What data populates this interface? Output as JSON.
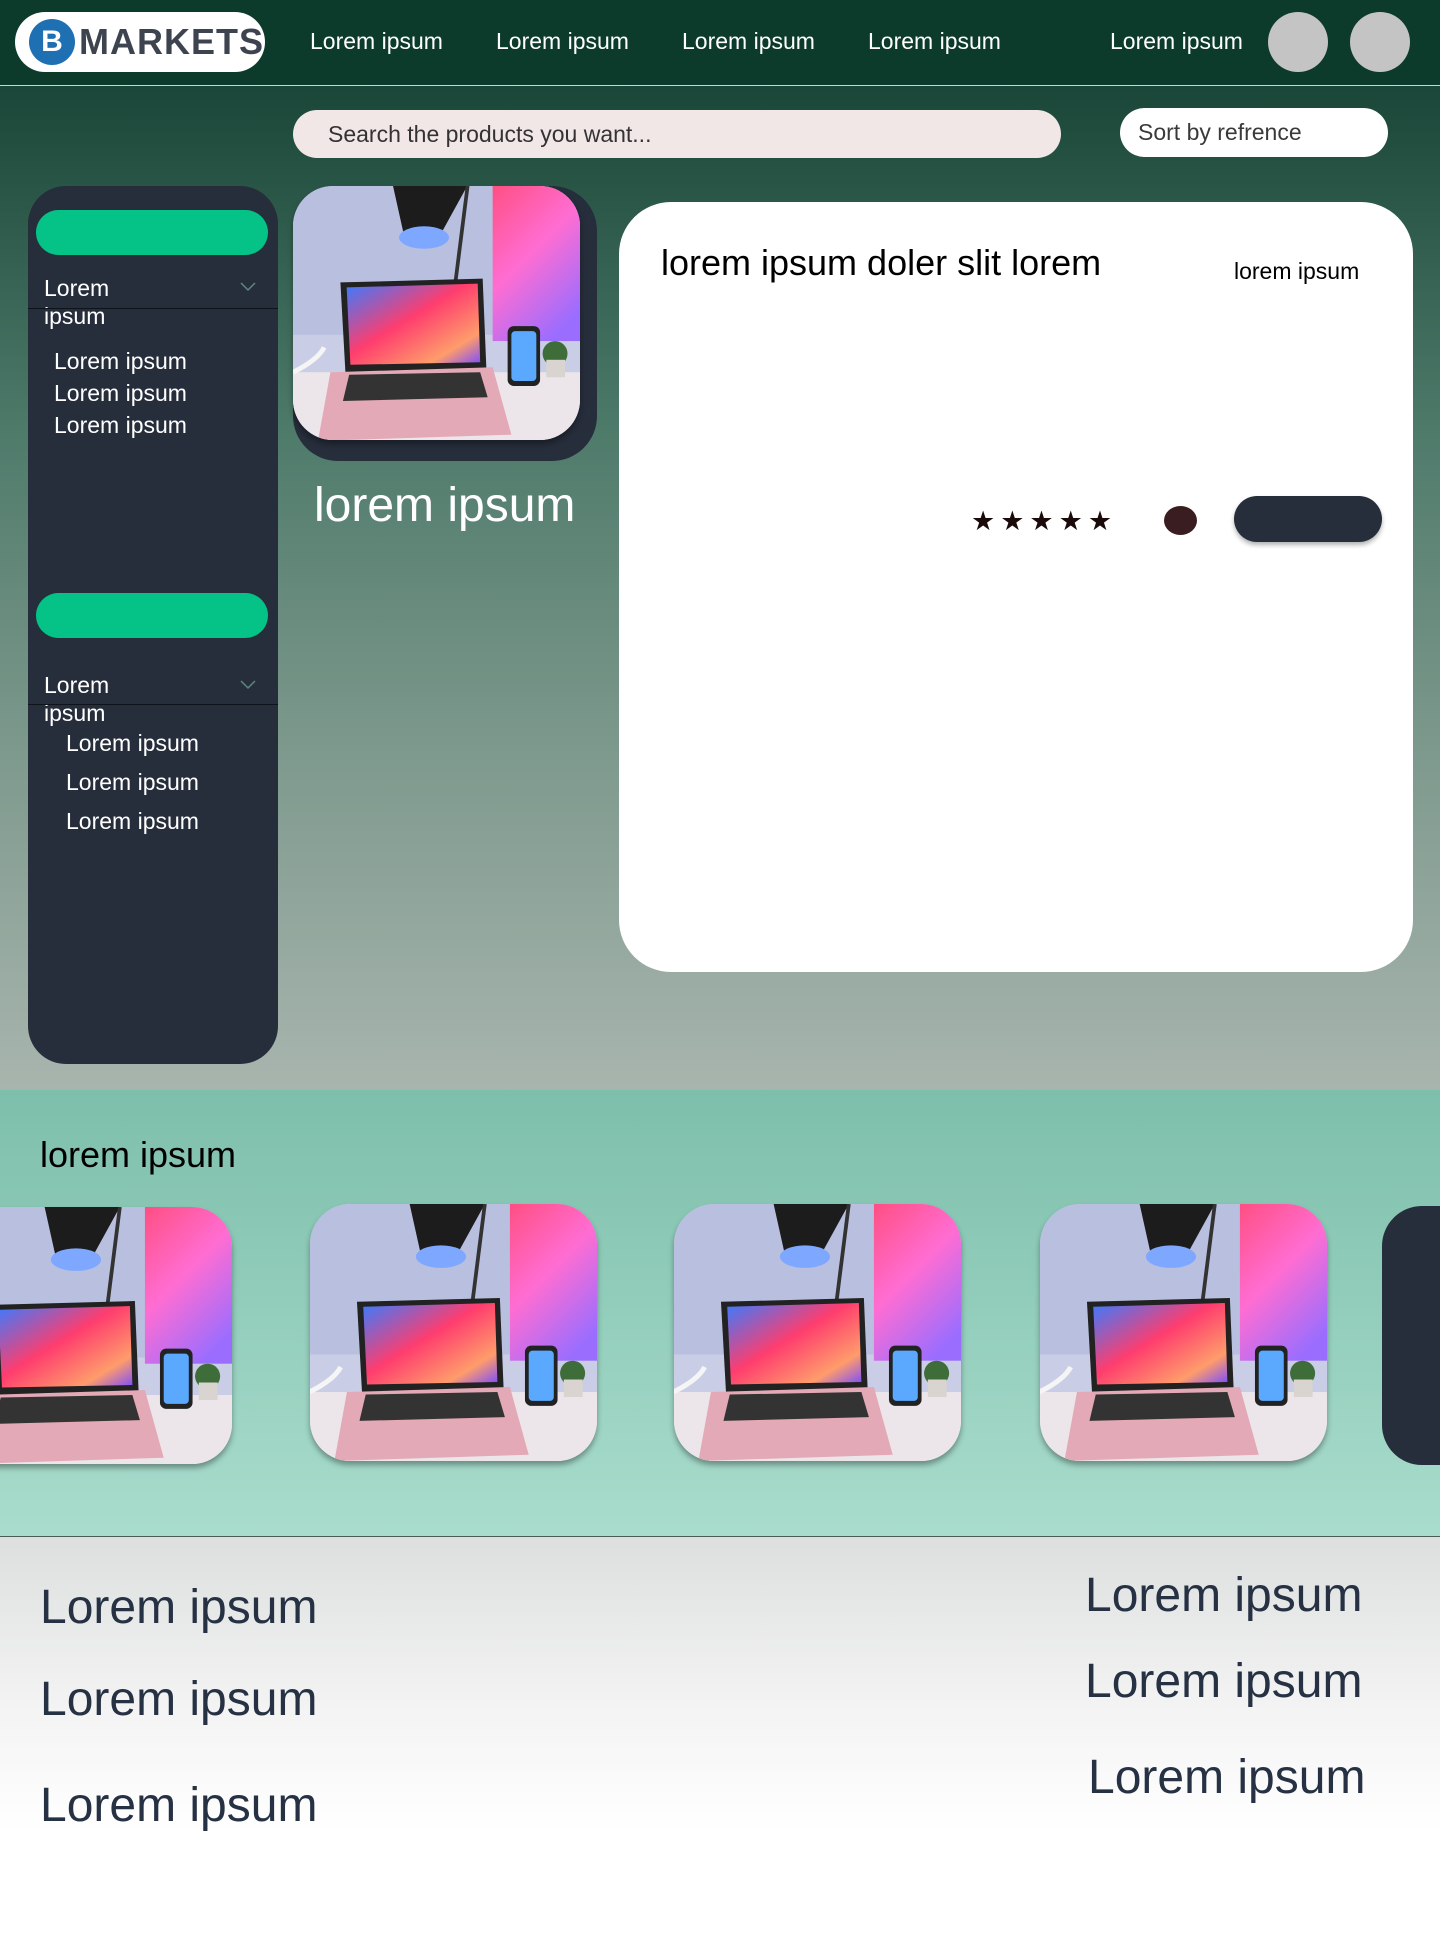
{
  "navbar": {
    "logo_letter": "B",
    "logo_text": "MARKETS",
    "links": [
      "Lorem ipsum",
      "Lorem ipsum",
      "Lorem ipsum",
      "Lorem ipsum"
    ],
    "right_link": "Lorem ipsum"
  },
  "search": {
    "placeholder": "Search the products you want..."
  },
  "sort": {
    "label": "Sort by refrence"
  },
  "sidebar": {
    "groups": [
      {
        "heading": "Lorem ipsum",
        "items": [
          "Lorem ipsum",
          "Lorem ipsum",
          "Lorem ipsum"
        ]
      },
      {
        "heading": "Lorem ipsum",
        "items": [
          "Lorem ipsum",
          "Lorem ipsum",
          "Lorem ipsum"
        ]
      }
    ]
  },
  "featured": {
    "title": "lorem ipsum"
  },
  "detail": {
    "title": "lorem ipsum doler slit lorem",
    "side_text": "lorem ipsum",
    "stars": "★★★★★"
  },
  "carousel": {
    "title": "lorem ipsum"
  },
  "footer": {
    "left_links": [
      "Lorem ipsum",
      "Lorem ipsum",
      "Lorem ipsum"
    ],
    "right_links": [
      "Lorem ipsum",
      "Lorem ipsum",
      "Lorem ipsum"
    ]
  },
  "colors": {
    "nav_bg": "#0c3a2b",
    "panel_dark": "#262d3b",
    "accent_green": "#05c286",
    "dot": "#3a1d21"
  }
}
